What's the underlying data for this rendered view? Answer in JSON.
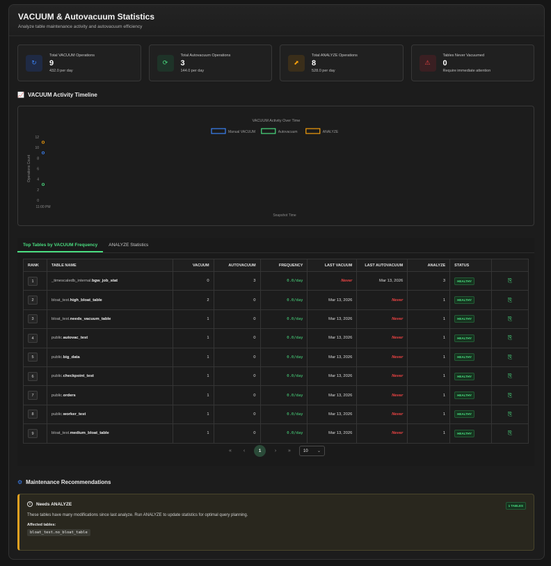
{
  "header": {
    "title": "VACUUM & Autovacuum Statistics",
    "subtitle": "Analyze table maintenance activity and autovacuum efficiency"
  },
  "stats": [
    {
      "label": "Total VACUUM Operations",
      "value": "9",
      "note": "432.0 per day",
      "icon": "refresh-icon",
      "color": "#3b82f6",
      "bg": "#1f2a44"
    },
    {
      "label": "Total Autovacuum Operations",
      "value": "3",
      "note": "144.0 per day",
      "icon": "rotate-icon",
      "color": "#4ade80",
      "bg": "#1e3328"
    },
    {
      "label": "Total ANALYZE Operations",
      "value": "8",
      "note": "528.0 per day",
      "icon": "chart-icon",
      "color": "#f59e0b",
      "bg": "#3a2e1a"
    },
    {
      "label": "Tables Never Vacuumed",
      "value": "0",
      "note": "Require immediate attention",
      "icon": "warning-icon",
      "color": "#ef4444",
      "bg": "#3a1f22"
    }
  ],
  "timeline": {
    "section_title": "VACUUM Activity Timeline"
  },
  "chart_data": {
    "type": "line",
    "title": "VACUUM Activity Over Time",
    "xlabel": "Snapshot Time",
    "ylabel": "Operations Count",
    "ylim": [
      0,
      12
    ],
    "yticks": [
      "0",
      "2",
      "4",
      "6",
      "8",
      "10",
      "12"
    ],
    "x": [
      "11:00 PM"
    ],
    "legend_position": "top",
    "series": [
      {
        "name": "Manual VACUUM",
        "values": [
          9
        ],
        "color": "#3b82f6"
      },
      {
        "name": "Autovacuum",
        "values": [
          3
        ],
        "color": "#4ade80"
      },
      {
        "name": "ANALYZE",
        "values": [
          11
        ],
        "color": "#f59e0b"
      }
    ]
  },
  "tabs": [
    {
      "label": "Top Tables by VACUUM Frequency",
      "active": true
    },
    {
      "label": "ANALYZE Statistics",
      "active": false
    }
  ],
  "table": {
    "headers": {
      "rank": "RANK",
      "name": "TABLE NAME",
      "vacuum": "VACUUM",
      "autovacuum": "AUTOVACUUM",
      "frequency": "FREQUENCY",
      "last_vacuum": "LAST VACUUM",
      "last_autovacuum": "LAST AUTOVACUUM",
      "analyze": "ANALYZE",
      "status": "STATUS"
    },
    "rows": [
      {
        "rank": "1",
        "schema": "_timescaledb_internal.",
        "name": "bgw_job_stat",
        "vacuum": "0",
        "autovacuum": "3",
        "frequency": "0.0/day",
        "last_vacuum": "Never",
        "last_autovacuum": "Mar 13, 2026",
        "analyze": "3",
        "status": "HEALTHY"
      },
      {
        "rank": "2",
        "schema": "bloat_test.",
        "name": "high_bloat_table",
        "vacuum": "2",
        "autovacuum": "0",
        "frequency": "0.0/day",
        "last_vacuum": "Mar 13, 2026",
        "last_autovacuum": "Never",
        "analyze": "1",
        "status": "HEALTHY"
      },
      {
        "rank": "3",
        "schema": "bloat_test.",
        "name": "needs_vacuum_table",
        "vacuum": "1",
        "autovacuum": "0",
        "frequency": "0.0/day",
        "last_vacuum": "Mar 13, 2026",
        "last_autovacuum": "Never",
        "analyze": "1",
        "status": "HEALTHY"
      },
      {
        "rank": "4",
        "schema": "public.",
        "name": "autovac_test",
        "vacuum": "1",
        "autovacuum": "0",
        "frequency": "0.0/day",
        "last_vacuum": "Mar 13, 2026",
        "last_autovacuum": "Never",
        "analyze": "1",
        "status": "HEALTHY"
      },
      {
        "rank": "5",
        "schema": "public.",
        "name": "big_data",
        "vacuum": "1",
        "autovacuum": "0",
        "frequency": "0.0/day",
        "last_vacuum": "Mar 13, 2026",
        "last_autovacuum": "Never",
        "analyze": "1",
        "status": "HEALTHY"
      },
      {
        "rank": "6",
        "schema": "public.",
        "name": "checkpoint_test",
        "vacuum": "1",
        "autovacuum": "0",
        "frequency": "0.0/day",
        "last_vacuum": "Mar 13, 2026",
        "last_autovacuum": "Never",
        "analyze": "1",
        "status": "HEALTHY"
      },
      {
        "rank": "7",
        "schema": "public.",
        "name": "orders",
        "vacuum": "1",
        "autovacuum": "0",
        "frequency": "0.0/day",
        "last_vacuum": "Mar 13, 2026",
        "last_autovacuum": "Never",
        "analyze": "1",
        "status": "HEALTHY"
      },
      {
        "rank": "8",
        "schema": "public.",
        "name": "worker_test",
        "vacuum": "1",
        "autovacuum": "0",
        "frequency": "0.0/day",
        "last_vacuum": "Mar 13, 2026",
        "last_autovacuum": "Never",
        "analyze": "1",
        "status": "HEALTHY"
      },
      {
        "rank": "9",
        "schema": "bloat_test.",
        "name": "medium_bloat_table",
        "vacuum": "1",
        "autovacuum": "0",
        "frequency": "0.0/day",
        "last_vacuum": "Mar 13, 2026",
        "last_autovacuum": "Never",
        "analyze": "1",
        "status": "HEALTHY"
      }
    ],
    "row_action_icon": "copy-icon"
  },
  "pagination": {
    "first": "«",
    "prev": "‹",
    "current": "1",
    "next": "›",
    "last": "»",
    "page_size": "10"
  },
  "recommendations": {
    "section_title": "Maintenance Recommendations",
    "card": {
      "title": "Needs ANALYZE",
      "badge": "1 TABLES",
      "description": "These tables have many modifications since last analyze. Run ANALYZE to update statistics for optimal query planning.",
      "affected_label": "Affected tables:",
      "tables": [
        "bloat_test.no_bloat_table"
      ]
    }
  }
}
